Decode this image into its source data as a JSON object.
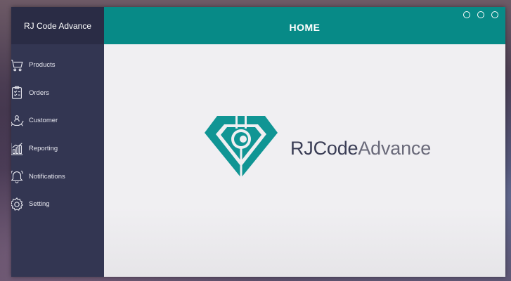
{
  "sidebar": {
    "app_title": "RJ Code Advance",
    "items": [
      {
        "label": "Products",
        "icon": "cart-icon"
      },
      {
        "label": "Orders",
        "icon": "clipboard-icon"
      },
      {
        "label": "Customer",
        "icon": "customer-hands-icon"
      },
      {
        "label": "Reporting",
        "icon": "chart-icon"
      },
      {
        "label": "Notifications",
        "icon": "bell-icon"
      },
      {
        "label": "Setting",
        "icon": "gear-icon"
      }
    ]
  },
  "header": {
    "title": "HOME"
  },
  "main": {
    "brand_strong": "RJCode",
    "brand_light": "Advance"
  },
  "colors": {
    "sidebar": "#333652",
    "sidebar_top": "#2a2c45",
    "accent": "#078a87",
    "content_bg": "#f0eff2"
  }
}
